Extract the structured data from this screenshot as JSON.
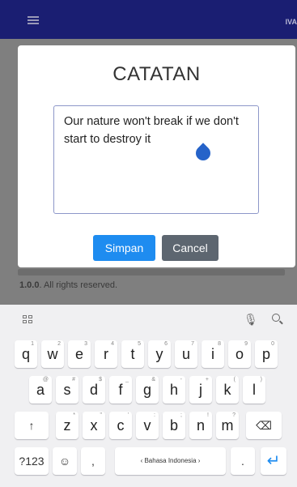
{
  "appbar": {
    "brand": "IVA",
    "menu_icon": "hamburger-icon"
  },
  "page": {
    "footer_version": "1.0.0",
    "footer_text": ". All rights reserved."
  },
  "modal": {
    "title": "CATATAN",
    "note_value": "Our nature won't break if we don't start to destroy it",
    "save_label": "Simpan",
    "cancel_label": "Cancel"
  },
  "keyboard": {
    "toolbar_icons": [
      "grid-icon",
      "mic-icon",
      "search-icon"
    ],
    "row1": [
      {
        "k": "q",
        "h": "1"
      },
      {
        "k": "w",
        "h": "2"
      },
      {
        "k": "e",
        "h": "3"
      },
      {
        "k": "r",
        "h": "4"
      },
      {
        "k": "t",
        "h": "5"
      },
      {
        "k": "y",
        "h": "6"
      },
      {
        "k": "u",
        "h": "7"
      },
      {
        "k": "i",
        "h": "8"
      },
      {
        "k": "o",
        "h": "9"
      },
      {
        "k": "p",
        "h": "0"
      }
    ],
    "row2": [
      {
        "k": "a",
        "h": "@"
      },
      {
        "k": "s",
        "h": "#"
      },
      {
        "k": "d",
        "h": "$"
      },
      {
        "k": "f",
        "h": "_"
      },
      {
        "k": "g",
        "h": "&"
      },
      {
        "k": "h",
        "h": "-"
      },
      {
        "k": "j",
        "h": "+"
      },
      {
        "k": "k",
        "h": "("
      },
      {
        "k": "l",
        "h": ")"
      }
    ],
    "row3": [
      {
        "k": "z",
        "h": "*"
      },
      {
        "k": "x",
        "h": "\""
      },
      {
        "k": "c",
        "h": "'"
      },
      {
        "k": "v",
        "h": ":"
      },
      {
        "k": "b",
        "h": ";"
      },
      {
        "k": "n",
        "h": "!"
      },
      {
        "k": "m",
        "h": "?"
      }
    ],
    "shift_label": "↑",
    "backspace_label": "⌫",
    "numbers_label": "?123",
    "emoji_label": "☺",
    "comma_label": ",",
    "space_label": "‹ Bahasa Indonesia ›",
    "period_label": ".",
    "enter_label": "↵"
  }
}
